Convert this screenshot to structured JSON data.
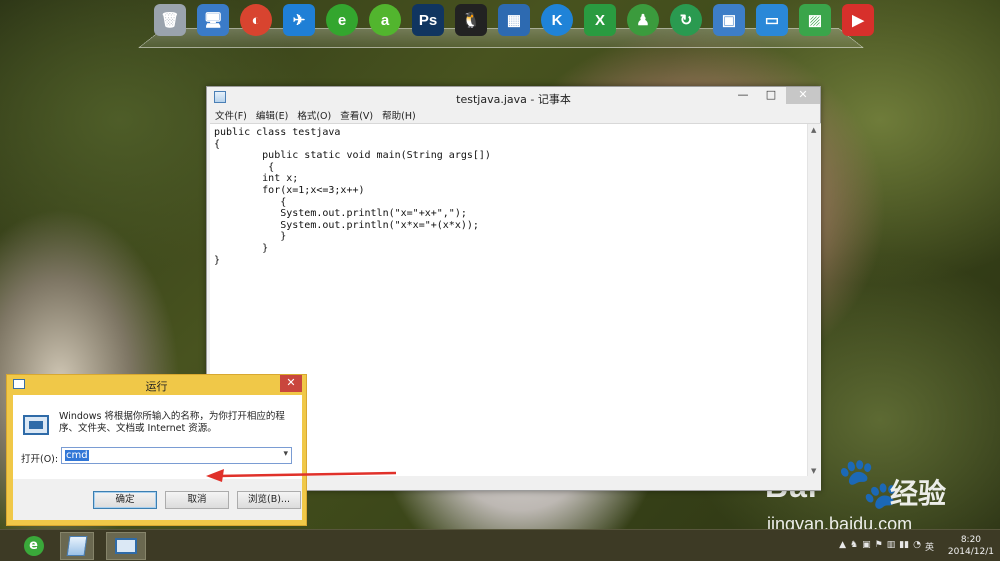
{
  "dock": {
    "icons": [
      {
        "name": "recycle-bin-icon",
        "glyph": "🗑",
        "color": "#9aa3ad"
      },
      {
        "name": "computer-icon",
        "glyph": "🖥",
        "color": "#3a7bc8"
      },
      {
        "name": "chrome-icon",
        "glyph": "◐",
        "color": "#d8442f"
      },
      {
        "name": "swallow-browser-icon",
        "glyph": "✈",
        "color": "#1f7fd6"
      },
      {
        "name": "ie-browser-icon",
        "glyph": "e",
        "color": "#33a62e"
      },
      {
        "name": "aliwangwang-icon",
        "glyph": "a",
        "color": "#52b52e"
      },
      {
        "name": "photoshop-icon",
        "glyph": "Ps",
        "color": "#103560"
      },
      {
        "name": "qq-icon",
        "glyph": "🐧",
        "color": "#222222"
      },
      {
        "name": "video-player-icon",
        "glyph": "▦",
        "color": "#2d6ab1"
      },
      {
        "name": "kugou-music-icon",
        "glyph": "K",
        "color": "#1f83d8"
      },
      {
        "name": "excel-icon",
        "glyph": "X",
        "color": "#2a9b40"
      },
      {
        "name": "user-contact-icon",
        "glyph": "♟",
        "color": "#3b9b3d"
      },
      {
        "name": "refresh-app-icon",
        "glyph": "↻",
        "color": "#2a9a50"
      },
      {
        "name": "window-switch-icon",
        "glyph": "▣",
        "color": "#3d7ec7"
      },
      {
        "name": "folder-icon",
        "glyph": "▭",
        "color": "#2a88d8"
      },
      {
        "name": "picture-icon",
        "glyph": "▨",
        "color": "#3aa54a"
      },
      {
        "name": "media-player-icon",
        "glyph": "▶",
        "color": "#d7302b"
      }
    ]
  },
  "notepad": {
    "title": "testjava.java - 记事本",
    "window_buttons": {
      "minimize": "—",
      "maximize": "□",
      "close": "✕"
    },
    "menu": [
      "文件(F)",
      "编辑(E)",
      "格式(O)",
      "查看(V)",
      "帮助(H)"
    ],
    "content": "public class testjava\n{\n        public static void main(String args[])\n         {\n        int x;\n        for(x=1;x<=3;x++)\n           {\n           System.out.println(\"x=\"+x+\",\");\n           System.out.println(\"x*x=\"+(x*x));\n           }\n        }\n}"
  },
  "run_dialog": {
    "title": "运行",
    "close": "✕",
    "description": "Windows 将根据你所输入的名称，为你打开相应的程序、文件夹、文档或 Internet 资源。",
    "open_label": "打开(O):",
    "input_value": "cmd",
    "ok": "确定",
    "cancel": "取消",
    "browse": "浏览(B)..."
  },
  "watermark": {
    "brand": "Bai",
    "brand2": "经验",
    "url": "jingyan.baidu.com"
  },
  "taskbar": {
    "tray_glyphs": [
      "▲",
      "♞",
      "▣",
      "⚑",
      "▥",
      "▮▮",
      "◔",
      "英"
    ],
    "time": "8:20",
    "date": "2014/12/1"
  },
  "colors": {
    "arrow": "#e0312a",
    "selection": "#3277d7",
    "dialog_frame": "#f0c848",
    "taskbar": "#3d3a25"
  }
}
